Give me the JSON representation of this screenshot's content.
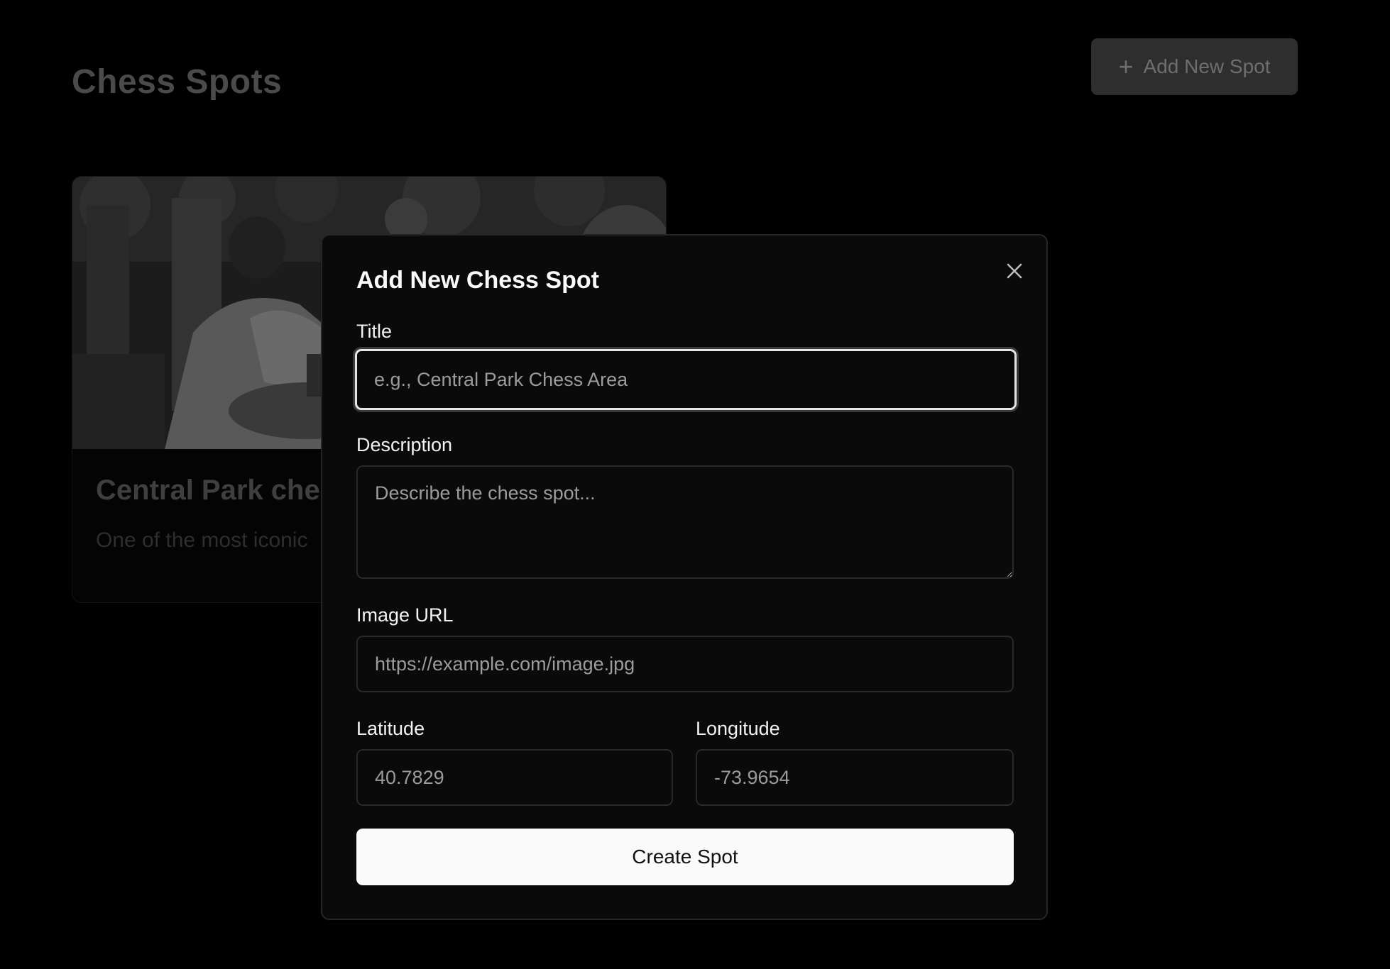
{
  "page": {
    "title": "Chess Spots",
    "add_button": {
      "label": "Add New Spot",
      "icon": "plus-icon"
    }
  },
  "cards": [
    {
      "title": "Central Park che",
      "description": "One of the most iconic"
    }
  ],
  "modal": {
    "title": "Add New Chess Spot",
    "close_icon": "close-icon",
    "fields": {
      "title": {
        "label": "Title",
        "placeholder": "e.g., Central Park Chess Area",
        "value": ""
      },
      "description": {
        "label": "Description",
        "placeholder": "Describe the chess spot...",
        "value": ""
      },
      "image_url": {
        "label": "Image URL",
        "placeholder": "https://example.com/image.jpg",
        "value": ""
      },
      "latitude": {
        "label": "Latitude",
        "placeholder": "40.7829",
        "value": ""
      },
      "longitude": {
        "label": "Longitude",
        "placeholder": "-73.9654",
        "value": ""
      }
    },
    "submit_label": "Create Spot"
  },
  "colors": {
    "background": "#000000",
    "modal_bg": "#0a0a0a",
    "primary_button_bg": "#fafafa",
    "primary_button_text": "#111111",
    "focus_ring": "#e6e6e6"
  }
}
